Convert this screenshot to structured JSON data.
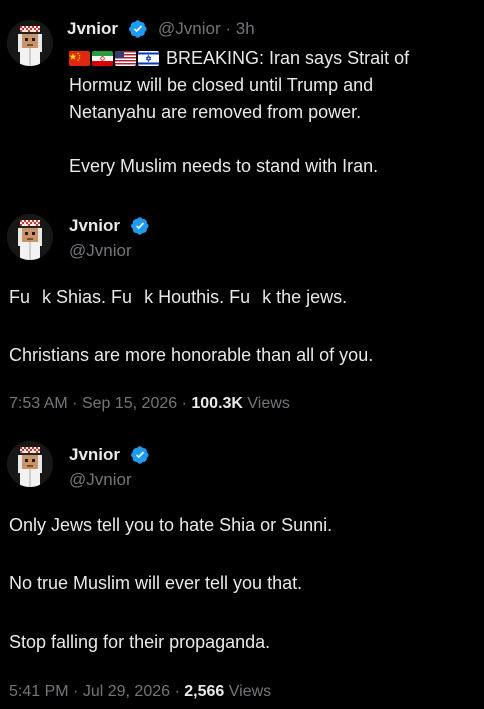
{
  "tweet1": {
    "display_name": "Jvnior",
    "handle": "@Jvnior",
    "separator": "·",
    "time": "3h",
    "flag_icons": [
      "china-flag-icon",
      "iran-flag-icon",
      "us-flag-icon",
      "israel-flag-icon"
    ],
    "line1": "BREAKING: Iran says Strait of",
    "line2": "Hormuz will be closed until Trump and",
    "line3": "Netanyahu are removed from power.",
    "line4": "Every Muslim needs to stand with Iran."
  },
  "tweet2": {
    "display_name": "Jvnior",
    "handle": "@Jvnior",
    "line1_a": "Fu",
    "line1_b": "k Shias. Fu",
    "line1_c": "k Houthis. Fu",
    "line1_d": "k the jews.",
    "line2": "Christians are more honorable than all of you.",
    "time": "7:53 AM",
    "sep1": "·",
    "date": "Sep 15, 2026",
    "sep2": "·",
    "views_count": "100.3K",
    "views_label": "Views"
  },
  "tweet3": {
    "display_name": "Jvnior",
    "handle": "@Jvnior",
    "line1": "Only Jews tell you to hate Shia or Sunni.",
    "line2": "No true Muslim will ever tell you that.",
    "line3": "Stop falling for their propaganda.",
    "time": "5:41 PM",
    "sep1": "·",
    "date": "Jul 29, 2026",
    "sep2": "·",
    "views_count": "2,566",
    "views_label": "Views"
  },
  "colors": {
    "background": "#000000",
    "text": "#e7e9ea",
    "muted": "#71767b",
    "verified": "#1d9bf0"
  }
}
